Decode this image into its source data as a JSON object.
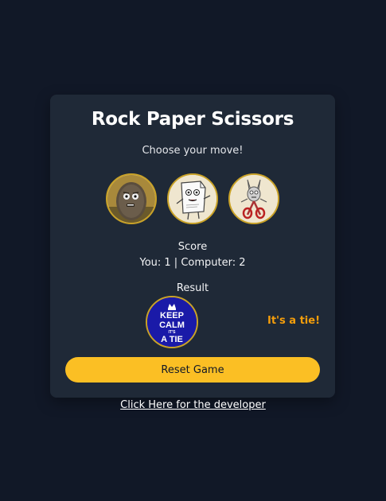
{
  "title": "Rock Paper Scissors",
  "subtitle": "Choose your move!",
  "moves": [
    {
      "name": "rock"
    },
    {
      "name": "paper"
    },
    {
      "name": "scissors"
    }
  ],
  "score": {
    "label": "Score",
    "line": "You: 1 | Computer: 2"
  },
  "result": {
    "label": "Result",
    "image_text": [
      "KEEP",
      "CALM",
      "IT'S",
      "A TIE"
    ],
    "message": "It's a tie!"
  },
  "reset_label": "Reset Game",
  "developer_link": "Click Here for the developer",
  "colors": {
    "background": "#111827",
    "card": "#1f2937",
    "accent": "#fbbf24",
    "result_text": "#f59e0b",
    "keep_calm_blue": "#1a1aa8"
  }
}
